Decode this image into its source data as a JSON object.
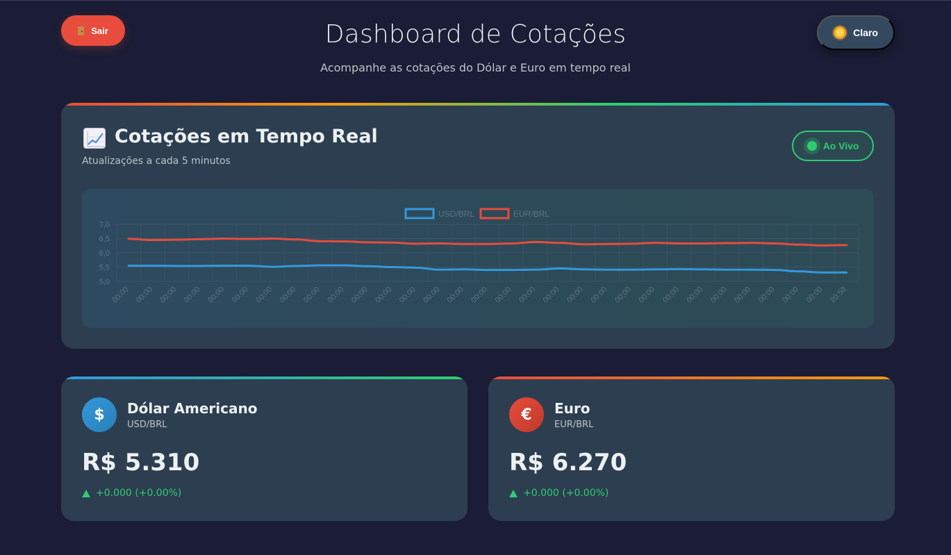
{
  "header": {
    "logout_label": "Sair",
    "theme_label": "Claro",
    "title": "Dashboard de Cotações",
    "subtitle": "Acompanhe as cotações do Dólar e Euro em tempo real"
  },
  "chart_card": {
    "icon": "chart-increasing-icon",
    "title": "Cotações em Tempo Real",
    "subtitle": "Atualizações a cada 5 minutos",
    "live_label": "Ao Vivo"
  },
  "chart_data": {
    "type": "line",
    "title": "",
    "xlabel": "",
    "ylabel": "",
    "ylim": [
      5.0,
      7.0
    ],
    "yticks": [
      "7,0",
      "6,5",
      "6,0",
      "5,5",
      "5,0"
    ],
    "ytick_values": [
      7.0,
      6.5,
      6.0,
      5.5,
      5.0
    ],
    "grid": true,
    "legend_position": "top-center",
    "x": [
      "00:00",
      "00:00",
      "00:00",
      "00:00",
      "00:00",
      "00:00",
      "00:00",
      "00:00",
      "00:00",
      "00:00",
      "00:00",
      "00:00",
      "00:00",
      "00:00",
      "00:00",
      "00:00",
      "00:00",
      "00:00",
      "00:00",
      "00:00",
      "00:00",
      "00:00",
      "00:00",
      "00:00",
      "00:00",
      "00:00",
      "00:00",
      "00:00",
      "00:00",
      "00:00",
      "20:58"
    ],
    "series": [
      {
        "name": "USD/BRL",
        "color": "#3498db",
        "values": [
          5.55,
          5.55,
          5.54,
          5.54,
          5.55,
          5.55,
          5.51,
          5.54,
          5.56,
          5.56,
          5.53,
          5.5,
          5.48,
          5.41,
          5.42,
          5.4,
          5.4,
          5.41,
          5.45,
          5.42,
          5.41,
          5.41,
          5.42,
          5.43,
          5.42,
          5.41,
          5.41,
          5.4,
          5.35,
          5.31,
          5.31
        ]
      },
      {
        "name": "EUR/BRL",
        "color": "#e74c3c",
        "values": [
          6.49,
          6.45,
          6.46,
          6.48,
          6.5,
          6.49,
          6.5,
          6.47,
          6.41,
          6.4,
          6.37,
          6.36,
          6.32,
          6.33,
          6.31,
          6.31,
          6.33,
          6.38,
          6.35,
          6.3,
          6.31,
          6.32,
          6.35,
          6.33,
          6.33,
          6.34,
          6.35,
          6.33,
          6.29,
          6.26,
          6.27
        ]
      }
    ]
  },
  "cards": {
    "usd": {
      "icon": "dollar-icon",
      "symbol": "$",
      "name": "Dólar Americano",
      "pair": "USD/BRL",
      "value": "R$ 5.310",
      "change": "+0.000 (+0.00%)"
    },
    "eur": {
      "icon": "euro-icon",
      "symbol": "€",
      "name": "Euro",
      "pair": "EUR/BRL",
      "value": "R$ 6.270",
      "change": "+0.000 (+0.00%)"
    }
  },
  "colors": {
    "background": "#1a1d35",
    "card": "#2c3e50",
    "danger": "#e74c3c",
    "success": "#2ecc71",
    "primary": "#3498db",
    "warning": "#f39c12"
  }
}
